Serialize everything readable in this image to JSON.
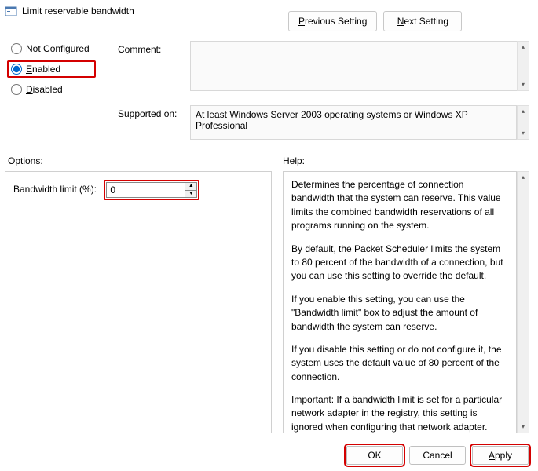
{
  "window": {
    "title": "Limit reservable bandwidth"
  },
  "nav": {
    "previous_html": "<span class='und'>P</span>revious Setting",
    "next_html": "<span class='und'>N</span>ext Setting"
  },
  "state": {
    "not_configured_html": "Not <span class='und'>C</span>onfigured",
    "enabled_html": "<span class='und'>E</span>nabled",
    "disabled_html": "<span class='und'>D</span>isabled",
    "selected": "enabled"
  },
  "labels": {
    "comment": "Comment:",
    "supported_on": "Supported on:",
    "options": "Options:",
    "help": "Help:",
    "bandwidth_limit": "Bandwidth limit (%):"
  },
  "fields": {
    "comment_value": "",
    "supported_value": "At least Windows Server 2003 operating systems or Windows XP Professional",
    "bandwidth_value": "0"
  },
  "help": {
    "p1": "Determines the percentage of connection bandwidth that the system can reserve. This value limits the combined bandwidth reservations of all programs running on the system.",
    "p2": "By default, the Packet Scheduler limits the system to 80 percent of the bandwidth of a connection, but you can use this setting to override the default.",
    "p3": "If you enable this setting, you can use the \"Bandwidth limit\" box to adjust the amount of bandwidth the system can reserve.",
    "p4": "If you disable this setting or do not configure it, the system uses the default value of 80 percent of the connection.",
    "p5": "Important: If a bandwidth limit is set for a particular network adapter in the registry, this setting is ignored when configuring that network adapter."
  },
  "buttons": {
    "ok": "OK",
    "cancel": "Cancel",
    "apply_html": "<span class='und'>A</span>pply"
  }
}
